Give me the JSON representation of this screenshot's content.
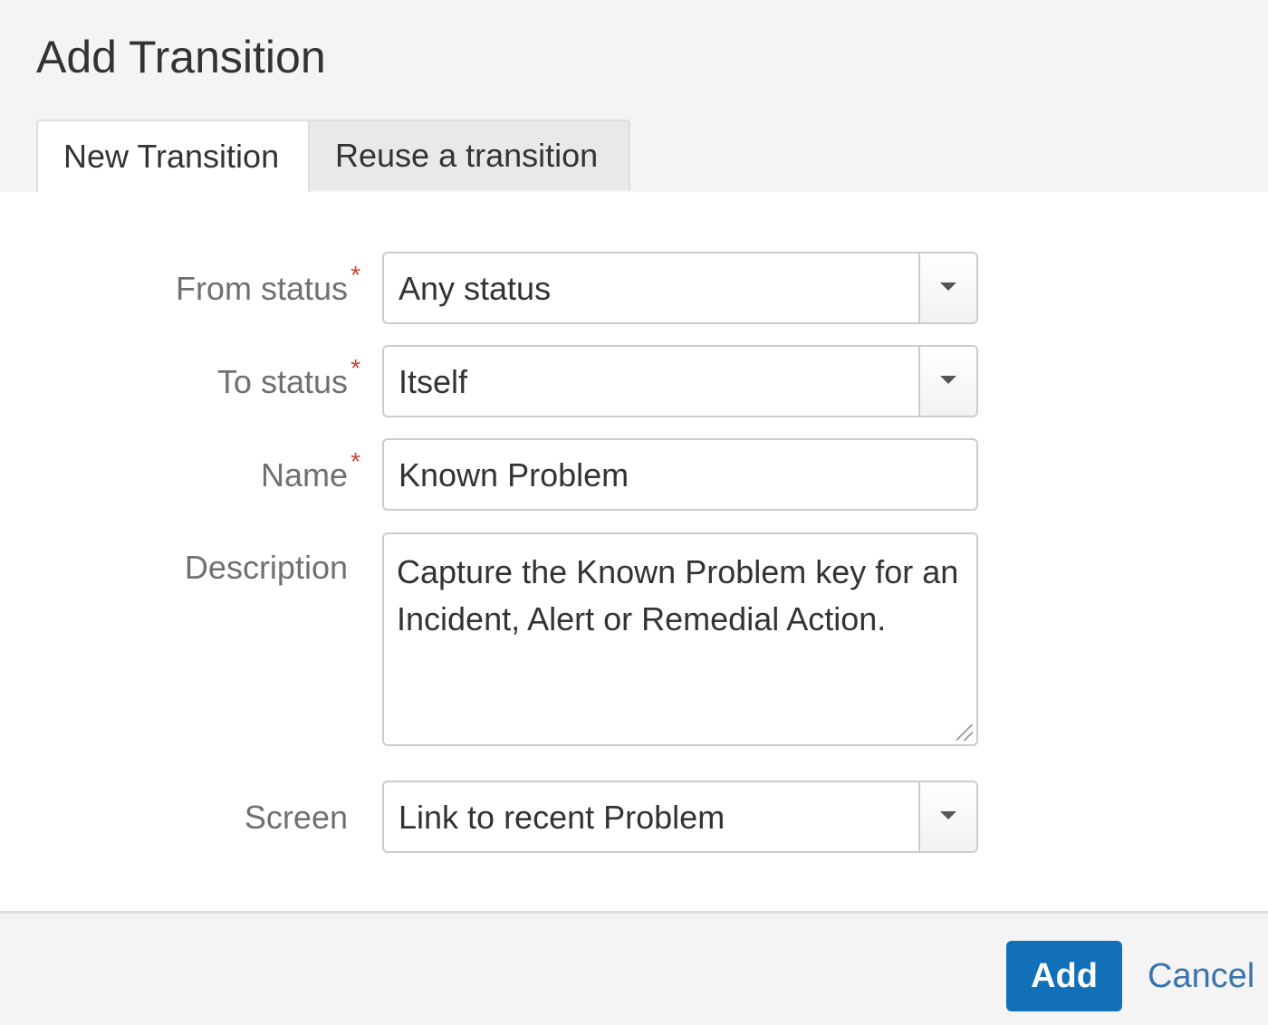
{
  "dialog": {
    "title": "Add Transition",
    "tabs": [
      {
        "label": "New Transition",
        "active": true
      },
      {
        "label": "Reuse a transition",
        "active": false
      }
    ]
  },
  "form": {
    "from_status": {
      "label": "From status",
      "required_marker": "*",
      "value": "Any status"
    },
    "to_status": {
      "label": "To status",
      "required_marker": "*",
      "value": "Itself"
    },
    "name": {
      "label": "Name",
      "required_marker": "*",
      "value": "Known Problem"
    },
    "description": {
      "label": "Description",
      "value": "Capture the Known Problem key for an Incident, Alert or Remedial Action."
    },
    "screen": {
      "label": "Screen",
      "value": "Link to recent Problem"
    }
  },
  "footer": {
    "add_label": "Add",
    "cancel_label": "Cancel"
  },
  "colors": {
    "primary": "#1270b8",
    "link": "#3b73af",
    "required": "#d04437"
  }
}
